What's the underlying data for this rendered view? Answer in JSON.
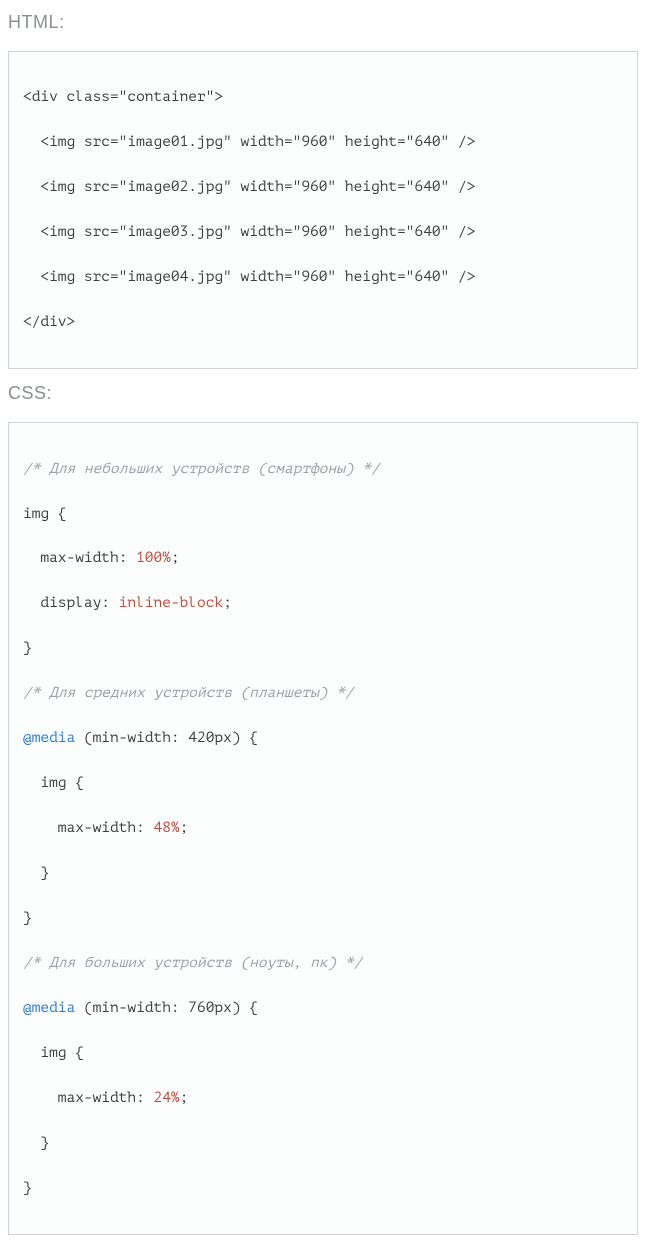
{
  "headings": {
    "html": "HTML:",
    "css": "CSS:"
  },
  "html_block": {
    "open": "<div class=\"container\">",
    "imgs": [
      "  <img src=\"image01.jpg\" width=\"960\" height=\"640\" />",
      "  <img src=\"image02.jpg\" width=\"960\" height=\"640\" />",
      "  <img src=\"image03.jpg\" width=\"960\" height=\"640\" />",
      "  <img src=\"image04.jpg\" width=\"960\" height=\"640\" />"
    ],
    "close": "</div>"
  },
  "css_block": {
    "c1": "/* Для небольших устройств (смартфоны) */",
    "r1_sel": "img",
    "r1_p1_prop": "max-width",
    "r1_p1_val": "100%",
    "r1_p2_prop": "display",
    "r1_p2_val": "inline-block",
    "c2": "/* Для средних устройств (планшеты) */",
    "m2_at": "@media",
    "m2_cond": "(min-width: 420px)",
    "m2_sel": "img",
    "m2_p_prop": "max-width",
    "m2_p_val": "48%",
    "c3": "/* Для больших устройств (ноуты, пк) */",
    "m3_at": "@media",
    "m3_cond": "(min-width: 760px)",
    "m3_sel": "img",
    "m3_p_prop": "max-width",
    "m3_p_val": "24%"
  },
  "punct": {
    "ob": " {",
    "cb": "}",
    "colon": ": ",
    "semi": ";",
    "sp": " "
  }
}
